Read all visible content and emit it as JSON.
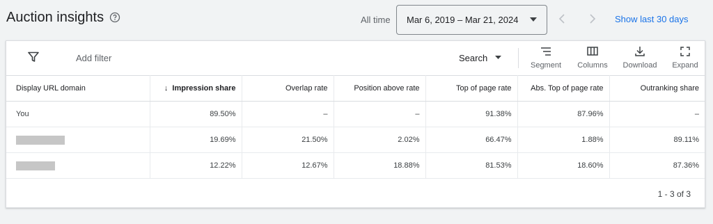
{
  "header": {
    "title": "Auction insights",
    "date_label": "All time",
    "date_range": "Mar 6, 2019 – Mar 21, 2024",
    "show_last_link": "Show last 30 days"
  },
  "toolbar": {
    "add_filter": "Add filter",
    "search_label": "Search",
    "tools": {
      "segment": "Segment",
      "columns": "Columns",
      "download": "Download",
      "expand": "Expand"
    }
  },
  "table": {
    "columns": [
      "Display URL domain",
      "Impression share",
      "Overlap rate",
      "Position above rate",
      "Top of page rate",
      "Abs. Top of page rate",
      "Outranking share"
    ],
    "sorted_column": "Impression share",
    "rows": [
      {
        "domain": "You",
        "impression_share": "89.50%",
        "overlap_rate": "–",
        "position_above_rate": "–",
        "top_of_page_rate": "91.38%",
        "abs_top_of_page_rate": "87.96%",
        "outranking_share": "–"
      },
      {
        "domain": "",
        "redacted": true,
        "impression_share": "19.69%",
        "overlap_rate": "21.50%",
        "position_above_rate": "2.02%",
        "top_of_page_rate": "66.47%",
        "abs_top_of_page_rate": "1.88%",
        "outranking_share": "89.11%"
      },
      {
        "domain": "",
        "redacted": true,
        "impression_share": "12.22%",
        "overlap_rate": "12.67%",
        "position_above_rate": "18.88%",
        "top_of_page_rate": "81.53%",
        "abs_top_of_page_rate": "18.60%",
        "outranking_share": "87.36%"
      }
    ]
  },
  "pagination": "1 - 3 of 3",
  "colors": {
    "accent": "#1a73e8",
    "background": "#f1f3f4",
    "card": "#ffffff",
    "redaction": "#c6c6c6"
  },
  "icons": [
    "help-icon",
    "chevron-down-icon",
    "chevron-left-icon",
    "chevron-right-icon",
    "filter-icon",
    "segment-icon",
    "columns-icon",
    "download-icon",
    "expand-icon",
    "arrow-down-icon"
  ]
}
